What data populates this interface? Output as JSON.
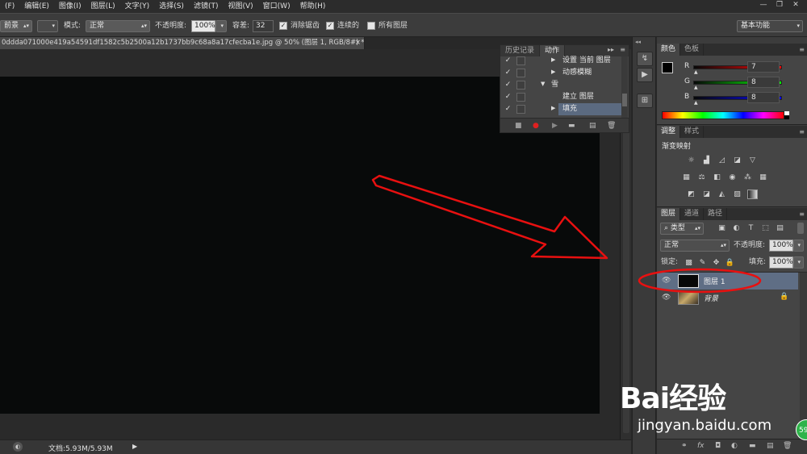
{
  "menubar": {
    "items": [
      "(F)",
      "编辑(E)",
      "图像(I)",
      "图层(L)",
      "文字(Y)",
      "选择(S)",
      "滤镜(T)",
      "视图(V)",
      "窗口(W)",
      "帮助(H)"
    ]
  },
  "options": {
    "fill_source": "前景",
    "mode_label": "模式:",
    "mode_value": "正常",
    "opacity_label": "不透明度:",
    "opacity_value": "100%",
    "tolerance_label": "容差:",
    "tolerance_value": "32",
    "antialias_label": "消除锯齿",
    "contiguous_label": "连续的",
    "all_layers_label": "所有图层",
    "workspace": "基本功能"
  },
  "document": {
    "tab_title": "0ddda071000e419a54591df1582c5b2500a12b1737bb9c68a8a17cfecba1e.jpg @ 50% (图层 1, RGB/8#) *",
    "tab_close": "×",
    "status_text": "文档:5.93M/5.93M"
  },
  "actions_panel": {
    "tabs": [
      "历史记录",
      "动作"
    ],
    "rows": [
      "设置 当前 图层",
      "动感模糊",
      "雪",
      "建立 图层",
      "填充"
    ]
  },
  "color_panel": {
    "tabs": [
      "颜色",
      "色板"
    ],
    "channels": [
      {
        "name": "R",
        "value": "7",
        "color": "#ff0000"
      },
      {
        "name": "G",
        "value": "8",
        "color": "#00cc00"
      },
      {
        "name": "B",
        "value": "8",
        "color": "#0000ff"
      }
    ]
  },
  "adjust_panel": {
    "tabs": [
      "调整",
      "样式"
    ],
    "title": "渐变映射"
  },
  "layers_panel": {
    "tabs": [
      "图层",
      "通道",
      "路径"
    ],
    "filter_kind": "类型",
    "blend_mode": "正常",
    "opacity_label": "不透明度:",
    "opacity_value": "100%",
    "lock_label": "锁定:",
    "fill_label": "填充:",
    "fill_value": "100%",
    "layers": [
      {
        "name": "图层 1",
        "selected": true
      },
      {
        "name": "背景",
        "selected": false
      }
    ]
  },
  "watermark": {
    "brand": "Bai经验",
    "url": "jingyan.baidu.com",
    "badge": "59"
  }
}
